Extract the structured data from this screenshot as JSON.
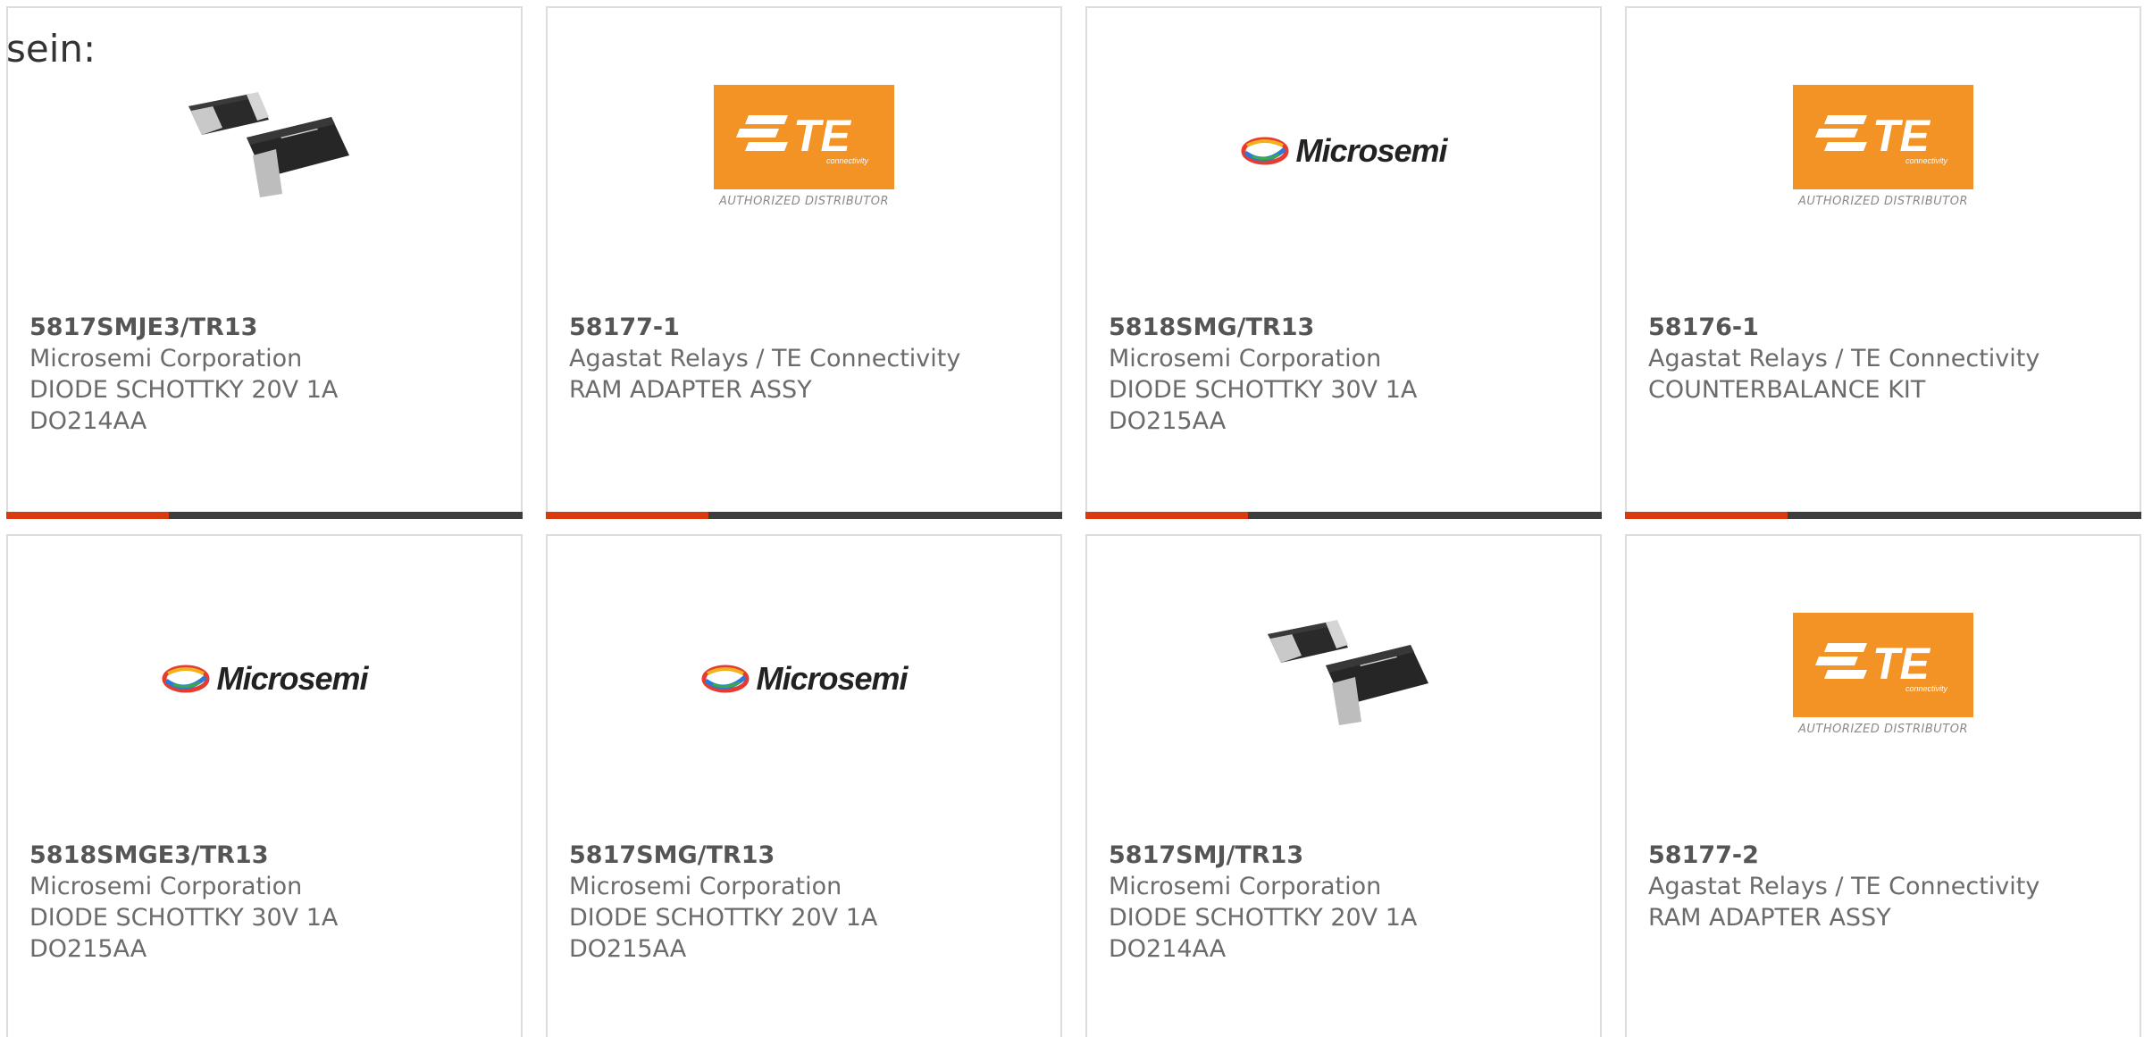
{
  "leading_text": "sein:",
  "logos": {
    "te_mark": "TE",
    "te_sub": "connectivity",
    "te_caption": "AUTHORIZED DISTRIBUTOR",
    "microsemi": "Microsemi"
  },
  "colors": {
    "accent_bar": "#d93a10",
    "bar_dark": "#3d3d3d",
    "te_orange": "#f39325",
    "card_border": "#dcdcdc"
  },
  "products": [
    {
      "part": "5817SMJE3/TR13",
      "manufacturer": "Microsemi Corporation",
      "desc1": "DIODE SCHOTTKY 20V 1A",
      "desc2": "DO214AA",
      "image": "diode-photo"
    },
    {
      "part": "58177-1",
      "manufacturer": "Agastat Relays / TE Connectivity",
      "desc1": "RAM ADAPTER ASSY",
      "desc2": "",
      "image": "te-logo"
    },
    {
      "part": "5818SMG/TR13",
      "manufacturer": "Microsemi Corporation",
      "desc1": "DIODE SCHOTTKY 30V 1A",
      "desc2": "DO215AA",
      "image": "microsemi-logo"
    },
    {
      "part": "58176-1",
      "manufacturer": "Agastat Relays / TE Connectivity",
      "desc1": "COUNTERBALANCE KIT",
      "desc2": "",
      "image": "te-logo"
    },
    {
      "part": "5818SMGE3/TR13",
      "manufacturer": "Microsemi Corporation",
      "desc1": "DIODE SCHOTTKY 30V 1A",
      "desc2": "DO215AA",
      "image": "microsemi-logo"
    },
    {
      "part": "5817SMG/TR13",
      "manufacturer": "Microsemi Corporation",
      "desc1": "DIODE SCHOTTKY 20V 1A",
      "desc2": "DO215AA",
      "image": "microsemi-logo"
    },
    {
      "part": "5817SMJ/TR13",
      "manufacturer": "Microsemi Corporation",
      "desc1": "DIODE SCHOTTKY 20V 1A",
      "desc2": "DO214AA",
      "image": "diode-photo"
    },
    {
      "part": "58177-2",
      "manufacturer": "Agastat Relays / TE Connectivity",
      "desc1": "RAM ADAPTER ASSY",
      "desc2": "",
      "image": "te-logo"
    }
  ]
}
